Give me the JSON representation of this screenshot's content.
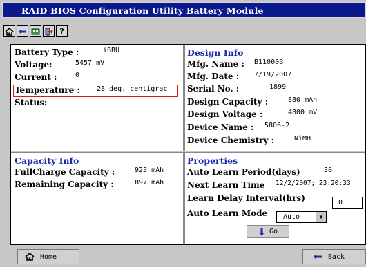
{
  "window": {
    "title": "RAID BIOS Configuration Utility Battery Module"
  },
  "toolbar": {
    "icons": [
      "home-icon",
      "back-arrow-icon",
      "adapter-icon",
      "exit-icon",
      "help-icon"
    ]
  },
  "battery": {
    "type_label": "Battery Type :",
    "type_value": "iBBU",
    "voltage_label": "Voltage:",
    "voltage_value": "5457 mV",
    "current_label": "Current :",
    "current_value": "0",
    "temperature_label": "Temperature :",
    "temperature_value": "28 deg. centigrac",
    "status_label": "Status:"
  },
  "design": {
    "header": "Design Info",
    "mfg_name_label": "Mfg. Name :",
    "mfg_name_value": "B11000B",
    "mfg_date_label": "Mfg. Date :",
    "mfg_date_value": "7/19/2007",
    "serial_label": "Serial No. :",
    "serial_value": "1899",
    "capacity_label": "Design Capacity :",
    "capacity_value": "880 mAh",
    "voltage_label": "Design Voltage :",
    "voltage_value": "4800 mV",
    "device_name_label": "Device Name :",
    "device_name_value": "5806-2",
    "chemistry_label": "Device Chemistry :",
    "chemistry_value": "NiMH"
  },
  "capacity": {
    "header": "Capacity Info",
    "full_label": "FullCharge Capacity :",
    "full_value": "923 mAh",
    "remaining_label": "Remaining Capacity :",
    "remaining_value": "897 mAh"
  },
  "properties": {
    "header": "Properties",
    "period_label": "Auto Learn Period(days)",
    "period_value": "30",
    "next_label": "Next Learn Time",
    "next_value": "12/2/2007; 23:20:33",
    "delay_label": "Learn Delay Interval(hrs)",
    "delay_value": "0",
    "mode_label": "Auto Learn Mode",
    "mode_value": "Auto",
    "go_label": "Go"
  },
  "footer": {
    "home_label": "Home",
    "back_label": "Back"
  }
}
